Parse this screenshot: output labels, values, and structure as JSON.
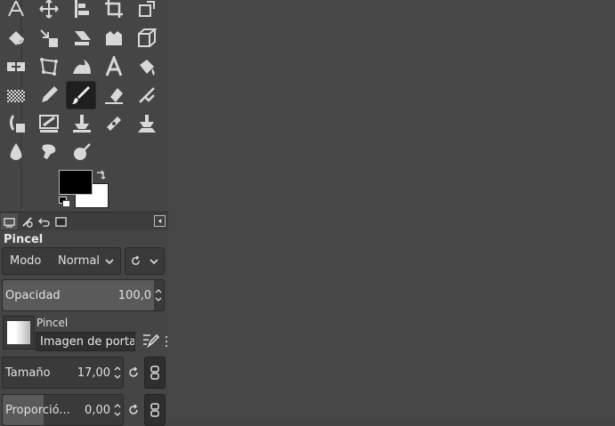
{
  "toolbox": {
    "tools": [
      {
        "name": "paths-tool-icon"
      },
      {
        "name": "move-tool-icon"
      },
      {
        "name": "align-tool-icon"
      },
      {
        "name": "crop-tool-icon"
      },
      {
        "name": "unified-transform-tool-icon"
      },
      {
        "name": "rotate-tool-icon"
      },
      {
        "name": "scale-tool-icon"
      },
      {
        "name": "shear-tool-icon"
      },
      {
        "name": "flip-tool-icon"
      },
      {
        "name": "perspective-tool-icon"
      },
      {
        "name": "warp-transform-tool-icon"
      },
      {
        "name": "cage-transform-tool-icon"
      },
      {
        "name": "wave-tool-icon"
      },
      {
        "name": "text-tool-icon"
      },
      {
        "name": "bucket-fill-tool-icon"
      },
      {
        "name": "gradient-tool-icon"
      },
      {
        "name": "pencil-tool-icon"
      },
      {
        "name": "paintbrush-tool-icon",
        "active": true
      },
      {
        "name": "eraser-tool-icon"
      },
      {
        "name": "airbrush-tool-icon"
      },
      {
        "name": "ink-tool-icon"
      },
      {
        "name": "mypaint-brush-tool-icon"
      },
      {
        "name": "clone-tool-icon"
      },
      {
        "name": "heal-tool-icon"
      },
      {
        "name": "perspective-clone-tool-icon"
      },
      {
        "name": "blur-sharpen-tool-icon"
      },
      {
        "name": "smudge-tool-icon"
      },
      {
        "name": "dodge-burn-tool-icon"
      }
    ],
    "colors": {
      "foreground": "#000000",
      "background": "#ffffff"
    }
  },
  "dock": {
    "tabs": [
      "tool-options-tab",
      "device-status-tab",
      "undo-history-tab",
      "images-tab"
    ]
  },
  "tool_options": {
    "title": "Pincel",
    "mode_label": "Modo",
    "mode_value": "Normal",
    "opacity_label": "Opacidad",
    "opacity_value": "100,0",
    "brush_label": "Pincel",
    "brush_name": "Imagen de portapapeles",
    "size_label": "Tamaño",
    "size_value": "17,00",
    "aspect_label": "Proporció...",
    "aspect_value": "0,00",
    "opacity_fraction": 1.0,
    "aspect_fraction": 0.34
  }
}
